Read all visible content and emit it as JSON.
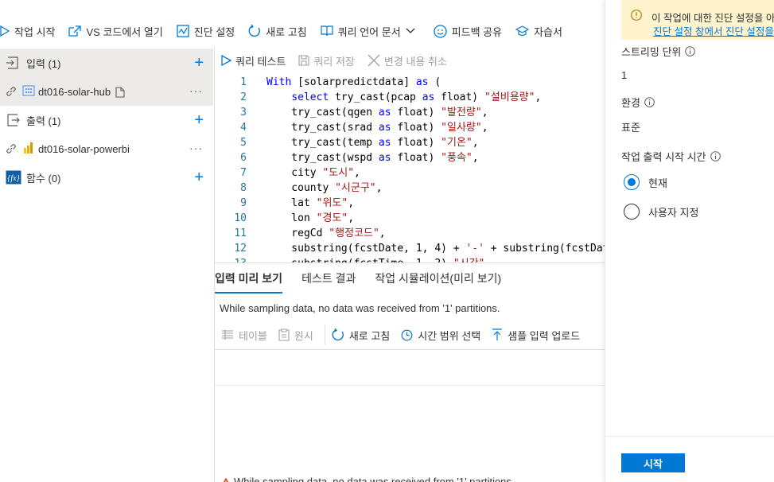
{
  "toolbar": {
    "start_job": "작업 시작",
    "open_vscode": "VS 코드에서 열기",
    "diagnostics": "진단 설정",
    "refresh": "새로 고침",
    "query_docs": "쿼리 언어 문서",
    "feedback": "피드백 공유",
    "tutorial": "자습서"
  },
  "left": {
    "inputs_label": "입력 (1)",
    "input_item": "dt016-solar-hub",
    "outputs_label": "출력 (1)",
    "output_item": "dt016-solar-powerbi",
    "functions_label": "함수 (0)"
  },
  "editor_bar": {
    "test_query": "쿼리 테스트",
    "save_query": "쿼리 저장",
    "discard": "변경 내용 취소"
  },
  "code": [
    {
      "n": "1",
      "parts": [
        [
          "kw",
          "With "
        ],
        [
          "plain",
          "[solarpredictdata] "
        ],
        [
          "kw",
          "as"
        ],
        [
          "plain",
          " ("
        ]
      ]
    },
    {
      "n": "2",
      "parts": [
        [
          "plain",
          "    "
        ],
        [
          "kw",
          "select "
        ],
        [
          "plain",
          "try_cast(pcap "
        ],
        [
          "kw",
          "as "
        ],
        [
          "plain",
          "float) "
        ],
        [
          "str",
          "\"설비용량\""
        ],
        [
          "plain",
          ","
        ]
      ]
    },
    {
      "n": "3",
      "parts": [
        [
          "plain",
          "    try_cast(qgen "
        ],
        [
          "kw",
          "as "
        ],
        [
          "plain",
          "float) "
        ],
        [
          "str",
          "\"발전량\""
        ],
        [
          "plain",
          ","
        ]
      ]
    },
    {
      "n": "4",
      "parts": [
        [
          "plain",
          "    try_cast(srad "
        ],
        [
          "kw",
          "as "
        ],
        [
          "plain",
          "float) "
        ],
        [
          "str",
          "\"일사량\""
        ],
        [
          "plain",
          ","
        ]
      ]
    },
    {
      "n": "5",
      "parts": [
        [
          "plain",
          "    try_cast(temp "
        ],
        [
          "kw",
          "as "
        ],
        [
          "plain",
          "float) "
        ],
        [
          "str",
          "\"기온\""
        ],
        [
          "plain",
          ","
        ]
      ]
    },
    {
      "n": "6",
      "parts": [
        [
          "plain",
          "    try_cast(wspd "
        ],
        [
          "kw",
          "as "
        ],
        [
          "plain",
          "float) "
        ],
        [
          "str",
          "\"풍속\""
        ],
        [
          "plain",
          ","
        ]
      ]
    },
    {
      "n": "7",
      "parts": [
        [
          "plain",
          "    city "
        ],
        [
          "str",
          "\"도시\""
        ],
        [
          "plain",
          ","
        ]
      ]
    },
    {
      "n": "8",
      "parts": [
        [
          "plain",
          "    county "
        ],
        [
          "str",
          "\"시군구\""
        ],
        [
          "plain",
          ","
        ]
      ]
    },
    {
      "n": "9",
      "parts": [
        [
          "plain",
          "    lat "
        ],
        [
          "str",
          "\"위도\""
        ],
        [
          "plain",
          ","
        ]
      ]
    },
    {
      "n": "10",
      "parts": [
        [
          "plain",
          "    lon "
        ],
        [
          "str",
          "\"경도\""
        ],
        [
          "plain",
          ","
        ]
      ]
    },
    {
      "n": "11",
      "parts": [
        [
          "plain",
          "    regCd "
        ],
        [
          "str",
          "\"행정코드\""
        ],
        [
          "plain",
          ","
        ]
      ]
    },
    {
      "n": "12",
      "parts": [
        [
          "plain",
          "    substring(fcstDate, 1, 4) + "
        ],
        [
          "str",
          "'-'"
        ],
        [
          "plain",
          " + substring(fcstDate"
        ]
      ]
    },
    {
      "n": "13",
      "parts": [
        [
          "plain",
          "    substring(fcstTime, 1, 2) "
        ],
        [
          "str",
          "\"시간\""
        ]
      ]
    }
  ],
  "bottom": {
    "tab_input_preview": "입력 미리 보기",
    "tab_test_results": "테스트 결과",
    "tab_simulation": "작업 시뮬레이션(미리 보기)",
    "sampling_msg": "While sampling data, no data was received from '1' partitions.",
    "table": "테이블",
    "raw": "원시",
    "refresh": "새로 고침",
    "time_range": "시간 범위 선택",
    "upload_sample": "샘플 입력 업로드",
    "warning": "While sampling data, no data was received from '1' partitions."
  },
  "right": {
    "notice_line1": "이 작업에 대한 진단 설정을 아직",
    "notice_line2": "진단 설정 창에서 진단 설정을 구",
    "streaming_units_label": "스트리밍 단위",
    "streaming_units_value": "1",
    "environment_label": "환경",
    "environment_value": "표준",
    "output_start_label": "작업 출력 시작 시간",
    "option_now": "현재",
    "option_custom": "사용자 지정",
    "selected_option": "현재",
    "start_button": "시작"
  },
  "colors": {
    "accent": "#0078d4",
    "notice_bg": "#fff4ce",
    "warning": "#d83b01"
  }
}
